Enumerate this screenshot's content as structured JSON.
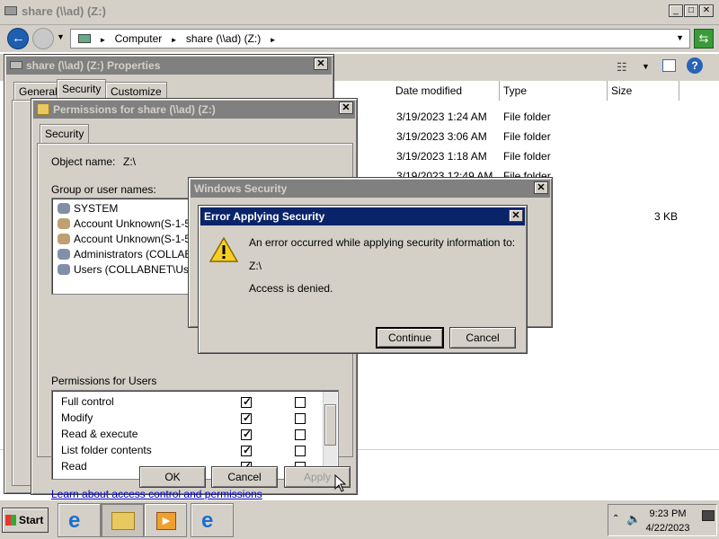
{
  "explorer": {
    "title": "share (\\\\ad) (Z:)",
    "address": [
      "Computer",
      "share (\\\\ad) (Z:)"
    ],
    "columns": [
      "Date modified",
      "Type",
      "Size"
    ],
    "rows": [
      {
        "date": "3/19/2023 1:24 AM",
        "type": "File folder",
        "size": ""
      },
      {
        "date": "3/19/2023 3:06 AM",
        "type": "File folder",
        "size": ""
      },
      {
        "date": "3/19/2023 1:18 AM",
        "type": "File folder",
        "size": ""
      },
      {
        "date": "3/19/2023 12:49 AM",
        "type": "File folder",
        "size": ""
      }
    ],
    "hidden_size": "3 KB"
  },
  "properties": {
    "title": "share (\\\\ad) (Z:) Properties",
    "tabs": [
      "General",
      "Security",
      "Customize"
    ]
  },
  "permissions": {
    "title": "Permissions for share (\\\\ad) (Z:)",
    "tab": "Security",
    "object_label": "Object name:",
    "object_value": "Z:\\",
    "group_label": "Group or user names:",
    "users": [
      "SYSTEM",
      "Account Unknown(S-1-5-21",
      "Account Unknown(S-1-5-21",
      "Administrators (COLLABNE",
      "Users (COLLABNET\\Users"
    ],
    "perm_label": "Permissions for Users",
    "perms": [
      {
        "name": "Full control",
        "allow": true,
        "deny": false
      },
      {
        "name": "Modify",
        "allow": true,
        "deny": false
      },
      {
        "name": "Read & execute",
        "allow": true,
        "deny": false
      },
      {
        "name": "List folder contents",
        "allow": true,
        "deny": false
      },
      {
        "name": "Read",
        "allow": true,
        "deny": false
      }
    ],
    "link": "Learn about access control and permissions",
    "ok": "OK",
    "cancel": "Cancel",
    "apply": "Apply"
  },
  "winsec": {
    "title": "Windows Security"
  },
  "error": {
    "title": "Error Applying Security",
    "message": "An error occurred while applying security information to:",
    "path": "Z:\\",
    "detail": "Access is denied.",
    "continue": "Continue",
    "cancel": "Cancel"
  },
  "taskbar": {
    "start": "Start",
    "time": "9:23 PM",
    "date": "4/22/2023"
  }
}
